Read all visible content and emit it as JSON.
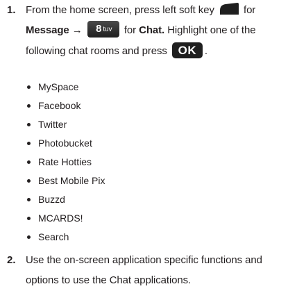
{
  "steps": [
    {
      "number": "1.",
      "line1_pre": "From the home screen, press left soft key",
      "line1_post": "for",
      "message_label": "Message",
      "arrow": "→",
      "for_text": "for",
      "chat_label": "Chat.",
      "highlight_text": "Highlight one of the",
      "line3_text": "following chat rooms and press",
      "period": "."
    },
    {
      "number": "2.",
      "line1": "Use the on-screen application specific functions and",
      "line2": "options to use the Chat applications."
    }
  ],
  "keys": {
    "left_softkey_icon": "left-soft-key-icon",
    "key8_digit": "8",
    "key8_letters": "tuv",
    "ok_label": "OK"
  },
  "chat_rooms": [
    "MySpace",
    "Facebook",
    "Twitter",
    "Photobucket",
    "Rate Hotties",
    "Best Mobile Pix",
    "Buzzd",
    "MCARDS!",
    "Search"
  ]
}
